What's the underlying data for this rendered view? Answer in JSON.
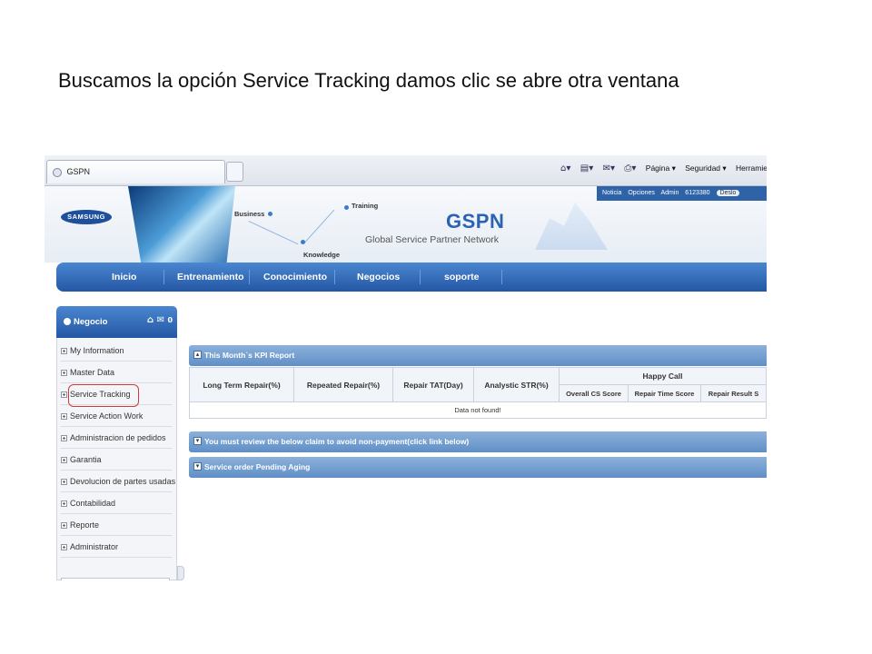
{
  "caption": "Buscamos la opción Service Tracking damos clic se abre otra ventana",
  "browser": {
    "tab_title": "GSPN",
    "commands": [
      "Página ▾",
      "Seguridad ▾",
      "Herramienta"
    ]
  },
  "header": {
    "logo": "SAMSUNG",
    "labels": {
      "business": "Business",
      "training": "Training",
      "knowledge": "Knowledge"
    },
    "brand": "GSPN",
    "subtitle": "Global Service Partner Network",
    "util_links": [
      "Noticia",
      "Opciones",
      "Admin"
    ],
    "user_id": "6123380",
    "logout": "Deslo"
  },
  "nav": {
    "items": [
      "Inicio",
      "Entrenamiento",
      "Conocimiento",
      "Negocios",
      "soporte"
    ]
  },
  "sidebar": {
    "title": "Negocio",
    "mail_count": "0",
    "items": [
      "My Information",
      "Master Data",
      "Service Tracking",
      "Service Action Work",
      "Administracion de pedidos",
      "Garantia",
      "Devolucion de partes usadas",
      "Contabilidad",
      "Reporte",
      "Administrator"
    ],
    "highlighted_item": "Service Tracking"
  },
  "kpi": {
    "title": "This Month`s KPI Report",
    "columns": [
      "Long Term Repair(%)",
      "Repeated Repair(%)",
      "Repair TAT(Day)",
      "Analystic STR(%)"
    ],
    "group_header": "Happy Call",
    "sub_columns": [
      "Overall CS Score",
      "Repair Time Score",
      "Repair Result S"
    ],
    "empty_message": "Data not found!"
  },
  "panels": {
    "claims": "You must review the below claim to avoid non-payment(click link below)",
    "pending": "Service order Pending Aging"
  },
  "colors": {
    "accent": "#2457a3",
    "highlight_circle": "#d23a3a"
  }
}
